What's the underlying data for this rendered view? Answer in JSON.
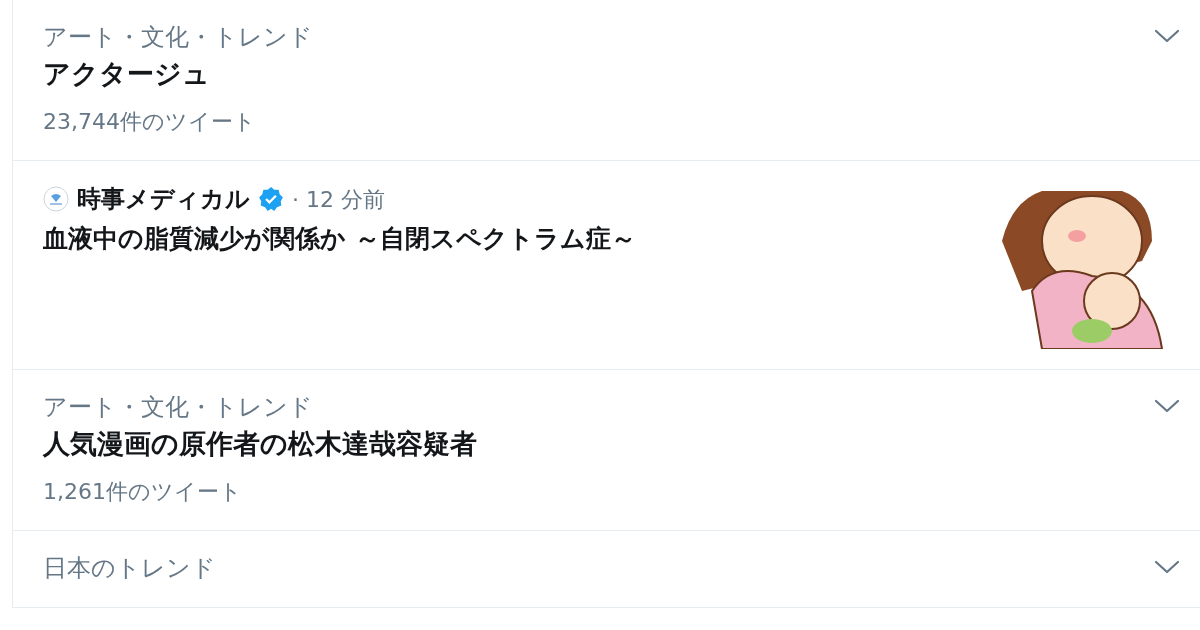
{
  "items": [
    {
      "kind": "trend",
      "category": "アート・文化・トレンド",
      "title": "アクタージュ",
      "count": "23,744件のツイート"
    },
    {
      "kind": "news",
      "source": "時事メディカル",
      "verified": true,
      "time": "· 12 分前",
      "title": "血液中の脂質減少が関係か ～自閉スペクトラム症～"
    },
    {
      "kind": "trend",
      "category": "アート・文化・トレンド",
      "title": "人気漫画の原作者の松木達哉容疑者",
      "count": "1,261件のツイート"
    },
    {
      "kind": "trend",
      "category": "日本のトレンド"
    }
  ]
}
